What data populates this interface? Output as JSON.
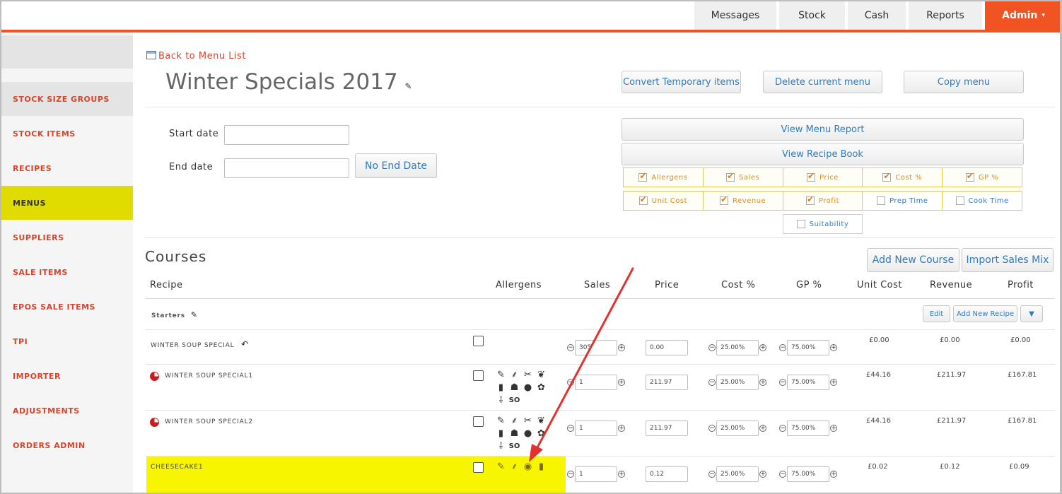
{
  "topnav": {
    "messages": "Messages",
    "stock": "Stock",
    "cash": "Cash",
    "reports": "Reports",
    "admin": "Admin",
    "admin_caret": "▾"
  },
  "sidebar": {
    "items": [
      {
        "label": "STOCK SIZE GROUPS"
      },
      {
        "label": "STOCK ITEMS"
      },
      {
        "label": "RECIPES"
      },
      {
        "label": "MENUS"
      },
      {
        "label": "SUPPLIERS"
      },
      {
        "label": "SALE ITEMS"
      },
      {
        "label": "EPOS SALE ITEMS"
      },
      {
        "label": "TPI"
      },
      {
        "label": "IMPORTER"
      },
      {
        "label": "ADJUSTMENTS"
      },
      {
        "label": "ORDERS ADMIN"
      }
    ],
    "active_index": 3
  },
  "header": {
    "back_link": "Back to Menu List",
    "title": "Winter Specials 2017",
    "edit_icon": "✎",
    "convert_button": "Convert Temporary items",
    "delete_button": "Delete current menu",
    "copy_button": "Copy menu"
  },
  "dates": {
    "start_label": "Start date",
    "end_label": "End date",
    "start_value": "",
    "end_value": "",
    "no_end_button": "No End Date"
  },
  "reports": {
    "view_menu_report": "View Menu Report",
    "view_recipe_book": "View Recipe Book"
  },
  "options": {
    "row1": [
      {
        "label": "Allergens",
        "checked": true
      },
      {
        "label": "Sales",
        "checked": true
      },
      {
        "label": "Price",
        "checked": true
      },
      {
        "label": "Cost %",
        "checked": true
      },
      {
        "label": "GP %",
        "checked": true
      }
    ],
    "row2": [
      {
        "label": "Unit Cost",
        "checked": true
      },
      {
        "label": "Revenue",
        "checked": true
      },
      {
        "label": "Profit",
        "checked": true
      },
      {
        "label": "Prep Time",
        "checked": false
      },
      {
        "label": "Cook Time",
        "checked": false
      }
    ],
    "row3": [
      {
        "label": "Suitability",
        "checked": false
      }
    ]
  },
  "courses": {
    "title": "Courses",
    "add_course_button": "Add New Course",
    "import_sales_button": "Import Sales Mix",
    "columns": [
      "Recipe",
      "Allergens",
      "Sales",
      "Price",
      "Cost %",
      "GP %",
      "Unit Cost",
      "Revenue",
      "Profit"
    ],
    "group": {
      "name": "Starters",
      "edit_button": "Edit",
      "add_recipe_button": "Add New Recipe",
      "dropdown_caret": "▼"
    },
    "rows": [
      {
        "name": "WINTER SOUP SPECIAL",
        "sales": "305",
        "price": "0.00",
        "cost_pct": "25.00%",
        "gp_pct": "75.00%",
        "unit_cost": "£0.00",
        "revenue": "£0.00",
        "profit": "£0.00"
      },
      {
        "name": "WINTER SOUP SPECIAL1",
        "sales": "1",
        "price": "211.97",
        "cost_pct": "25.00%",
        "gp_pct": "75.00%",
        "unit_cost": "£44.16",
        "revenue": "£211.97",
        "profit": "£167.81"
      },
      {
        "name": "WINTER SOUP SPECIAL2",
        "sales": "1",
        "price": "211.97",
        "cost_pct": "25.00%",
        "gp_pct": "75.00%",
        "unit_cost": "£44.16",
        "revenue": "£211.97",
        "profit": "£167.81"
      },
      {
        "name": "CHEESECAKE1",
        "sales": "1",
        "price": "0.12",
        "cost_pct": "25.00%",
        "gp_pct": "75.00%",
        "unit_cost": "£0.02",
        "revenue": "£0.12",
        "profit": "£0.09"
      }
    ],
    "allergen_label_so": "SO",
    "undo_icon": "↶",
    "minus": "−",
    "plus": "+"
  },
  "colors": {
    "brand_orange": "#f05423",
    "active_menu": "#e0dc00",
    "highlight": "#f7f500",
    "link_red": "#d9452c",
    "button_blue": "#2e7bbf",
    "arrow_red": "#e53030"
  }
}
